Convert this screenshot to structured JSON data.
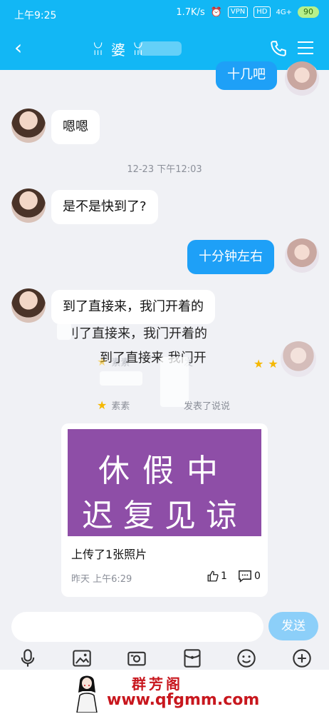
{
  "status": {
    "time": "上午9:25",
    "speed": "1.7K/s",
    "vpn": "VPN",
    "hd": "HD",
    "network": "4G+",
    "battery": "90"
  },
  "header": {
    "title": "ꈍ 婆 ꈍ",
    "back_icon": "back-arrow-icon",
    "call_icon": "phone-icon",
    "menu_icon": "hamburger-menu-icon"
  },
  "messages": [
    {
      "side": "out",
      "text": "十几吧"
    },
    {
      "side": "in",
      "text": "嗯嗯"
    },
    {
      "side": "time",
      "text": "12-23 下午12:03"
    },
    {
      "side": "in",
      "text": "是不是快到了?"
    },
    {
      "side": "out",
      "text": "十分钟左右"
    },
    {
      "side": "in",
      "text": "到了直接来，我门开着的"
    }
  ],
  "ghosts": {
    "line1": "刂了直接来，我门开着的",
    "line2": "到了直接来  我门开",
    "notice1": "素素",
    "notice1_tail": "发",
    "notice2_head": "素素",
    "notice2_tail": "发表了说说"
  },
  "card": {
    "image_line1": "休假中",
    "image_line2": "迟复见谅",
    "text": "上传了1张照片",
    "time": "昨天 上午6:29",
    "likes": "1",
    "comments": "0"
  },
  "input": {
    "placeholder": "",
    "value": "",
    "send_label": "发送"
  },
  "toolbar": [
    "microphone-icon",
    "image-icon",
    "camera-icon",
    "red-packet-icon",
    "emoji-icon",
    "plus-icon"
  ],
  "watermark": {
    "title": "群芳阁",
    "url": "www.qfgmm.com"
  },
  "colors": {
    "brand": "#12b7f5",
    "out_bubble": "#1ea0f7",
    "background": "#f0f1f5",
    "card_image": "#8e4ea7",
    "watermark": "#c8171e"
  }
}
